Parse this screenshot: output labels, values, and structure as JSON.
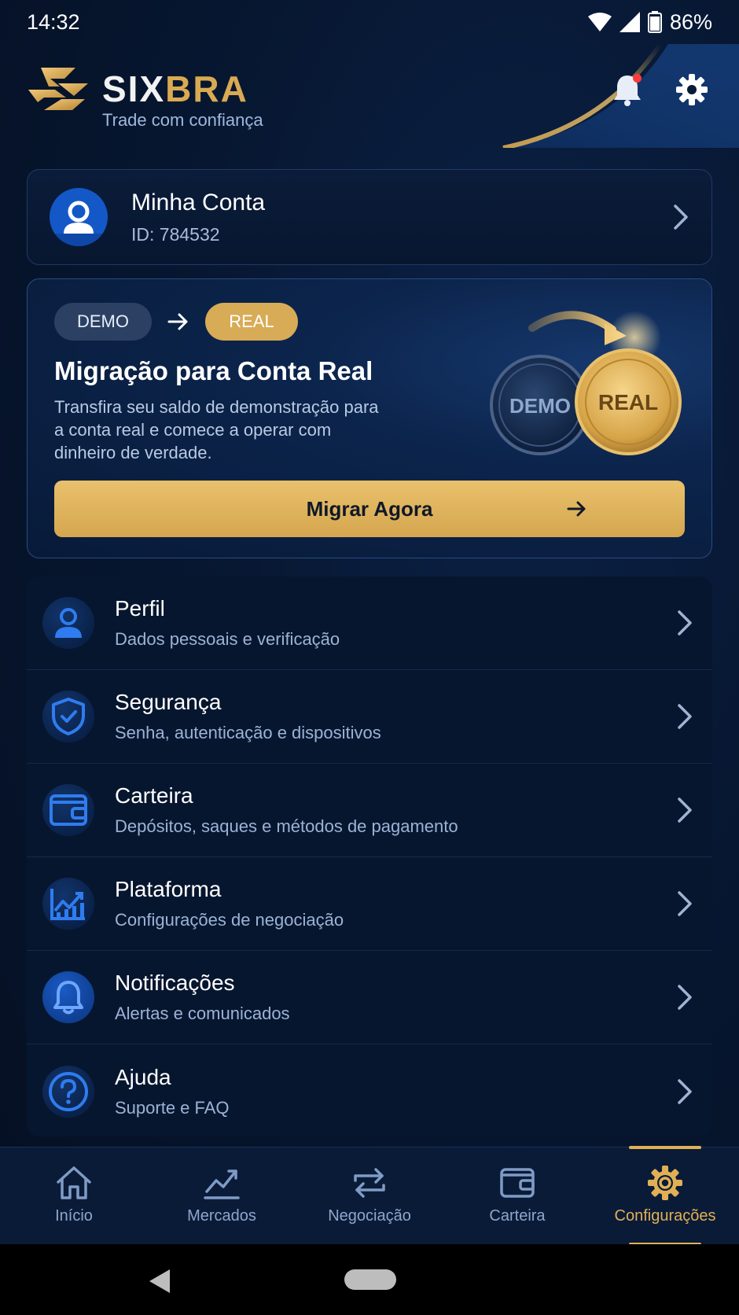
{
  "status_bar": {
    "time": "14:32",
    "battery": "86%"
  },
  "header": {
    "brand_part1": "SIX",
    "brand_part2": "BRA",
    "tagline": "Trade com confiança",
    "has_notification": true
  },
  "account": {
    "name": "Minha Conta",
    "id": "ID: 784532"
  },
  "migration": {
    "from_label": "DEMO",
    "to_label": "REAL",
    "title": "Migração para Conta Real",
    "description": "Transfira seu saldo de demonstração para a conta real e comece a operar com dinheiro de verdade.",
    "coin_demo": "DEMO",
    "coin_real": "REAL",
    "button_label": "Migrar Agora"
  },
  "menu": [
    {
      "icon": "user-icon",
      "title": "Perfil",
      "subtitle": "Dados pessoais e verificação"
    },
    {
      "icon": "shield-icon",
      "title": "Segurança",
      "subtitle": "Senha, autenticação e dispositivos"
    },
    {
      "icon": "wallet-icon",
      "title": "Carteira",
      "subtitle": "Depósitos, saques e métodos de pagamento"
    },
    {
      "icon": "chart-icon",
      "title": "Plataforma",
      "subtitle": "Configurações de negociação"
    },
    {
      "icon": "bell-icon",
      "title": "Notificações",
      "subtitle": "Alertas e comunicados"
    },
    {
      "icon": "help-icon",
      "title": "Ajuda",
      "subtitle": "Suporte e FAQ"
    }
  ],
  "bottom_nav": [
    {
      "icon": "home-icon",
      "label": "Início",
      "active": false
    },
    {
      "icon": "markets-icon",
      "label": "Mercados",
      "active": false
    },
    {
      "icon": "exchange-icon",
      "label": "Negociação",
      "active": false
    },
    {
      "icon": "wallet-icon",
      "label": "Carteira",
      "active": false
    },
    {
      "icon": "gear-icon",
      "label": "Configurações",
      "active": true
    }
  ],
  "colors": {
    "gold": "#d9aa52",
    "accent_blue": "#1f6fe5",
    "background": "#061226",
    "active_nav": "#e1b055"
  }
}
